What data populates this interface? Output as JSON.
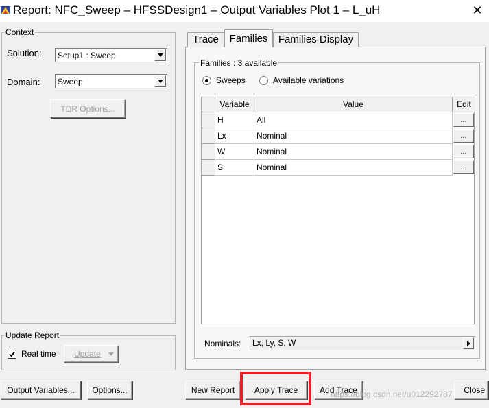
{
  "window": {
    "title": "Report: NFC_Sweep – HFSSDesign1 – Output Variables Plot 1 – L_uH",
    "close_glyph": "✕"
  },
  "context": {
    "legend": "Context",
    "solution_label": "Solution:",
    "solution_value": "Setup1 : Sweep",
    "domain_label": "Domain:",
    "domain_value": "Sweep",
    "tdr_button": "TDR Options..."
  },
  "update_report": {
    "legend": "Update Report",
    "realtime_label": "Real time",
    "realtime_checked": true,
    "update_button": "Update"
  },
  "tabs": [
    {
      "label": "Trace",
      "active": false
    },
    {
      "label": "Families",
      "active": true
    },
    {
      "label": "Families Display",
      "active": false
    }
  ],
  "families": {
    "legend": "Families : 3 available",
    "radio_sweeps": "Sweeps",
    "radio_sweeps_selected": true,
    "radio_variations": "Available variations",
    "columns": [
      "Variable",
      "Value",
      "Edit"
    ],
    "rows": [
      {
        "variable": "H",
        "value": "All",
        "edit": "..."
      },
      {
        "variable": "Lx",
        "value": "Nominal",
        "edit": "..."
      },
      {
        "variable": "W",
        "value": "Nominal",
        "edit": "..."
      },
      {
        "variable": "S",
        "value": "Nominal",
        "edit": "..."
      }
    ],
    "nominals_label": "Nominals:",
    "nominals_value": "Lx, Ly, S, W"
  },
  "bottom_buttons": {
    "output_variables": "Output Variables...",
    "options": "Options...",
    "new_report": "New Report",
    "apply_trace": "Apply Trace",
    "add_trace": "Add Trace",
    "close": "Close"
  },
  "watermark": "https://blog.csdn.net/u012292787",
  "colors": {
    "highlight": "#e8202a",
    "background": "#f0f0f0"
  }
}
